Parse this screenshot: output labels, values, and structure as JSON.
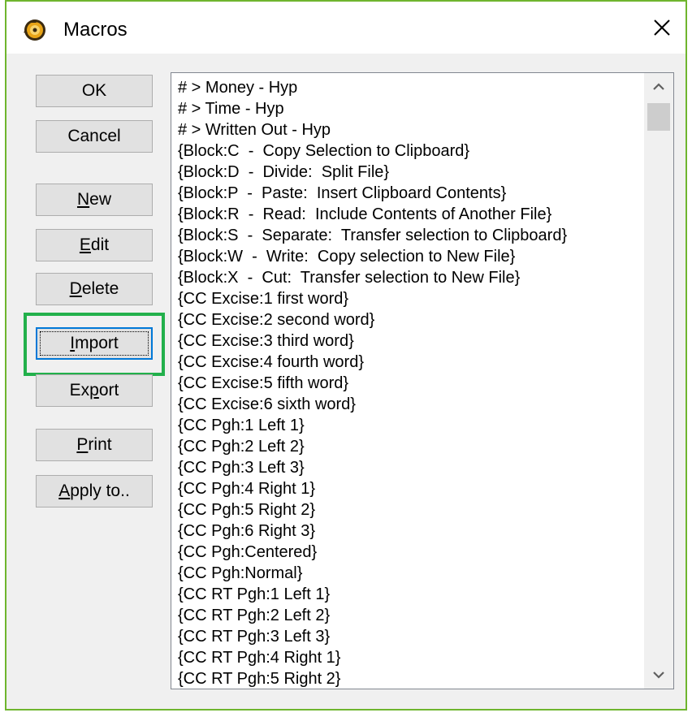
{
  "window": {
    "title": "Macros",
    "close_symbol": "✕"
  },
  "buttons": {
    "ok": "OK",
    "cancel": "Cancel",
    "new_mn": "N",
    "new_rest": "ew",
    "edit_mn": "E",
    "edit_rest": "dit",
    "delete_mn": "D",
    "delete_rest": "elete",
    "import_mn": "I",
    "import_rest": "mport",
    "export_pre": "Ex",
    "export_mn": "p",
    "export_rest": "ort",
    "print_mn": "P",
    "print_rest": "rint",
    "apply_mn": "A",
    "apply_rest": "pply to.."
  },
  "macro_list": [
    "# > Money - Hyp",
    "# > Time - Hyp",
    "# > Written Out - Hyp",
    "{Block:C  -  Copy Selection to Clipboard}",
    "{Block:D  -  Divide:  Split File}",
    "{Block:P  -  Paste:  Insert Clipboard Contents}",
    "{Block:R  -  Read:  Include Contents of Another File}",
    "{Block:S  -  Separate:  Transfer selection to Clipboard}",
    "{Block:W  -  Write:  Copy selection to New File}",
    "{Block:X  -  Cut:  Transfer selection to New File}",
    "{CC Excise:1 first word}",
    "{CC Excise:2 second word}",
    "{CC Excise:3 third word}",
    "{CC Excise:4 fourth word}",
    "{CC Excise:5 fifth word}",
    "{CC Excise:6 sixth word}",
    "{CC Pgh:1 Left 1}",
    "{CC Pgh:2 Left 2}",
    "{CC Pgh:3 Left 3}",
    "{CC Pgh:4 Right 1}",
    "{CC Pgh:5 Right 2}",
    "{CC Pgh:6 Right 3}",
    "{CC Pgh:Centered}",
    "{CC Pgh:Normal}",
    "{CC RT Pgh:1 Left 1}",
    "{CC RT Pgh:2 Left 2}",
    "{CC RT Pgh:3 Left 3}",
    "{CC RT Pgh:4 Right 1}",
    "{CC RT Pgh:5 Right 2}"
  ],
  "colors": {
    "highlight": "#22b04b",
    "focus": "#0078d7",
    "window_border": "#6fb52e"
  },
  "icons": {
    "app": "macro-app-icon",
    "close": "close-icon",
    "scroll_up": "chevron-up-icon",
    "scroll_down": "chevron-down-icon"
  }
}
